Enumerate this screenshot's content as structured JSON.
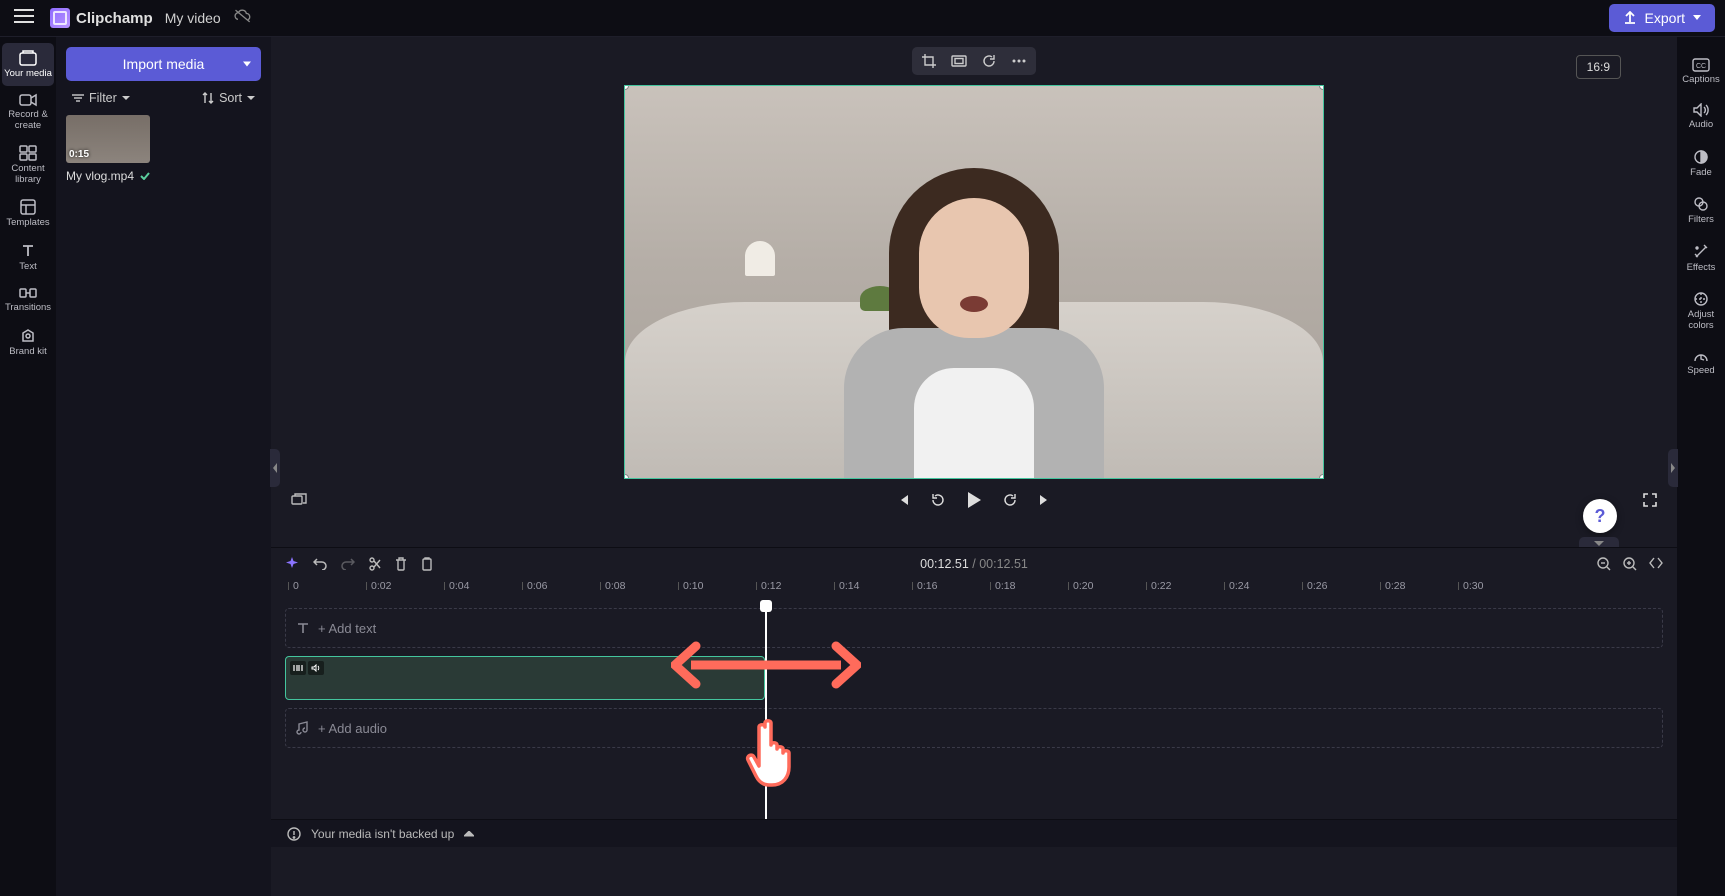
{
  "app": {
    "name": "Clipchamp",
    "video_name": "My video"
  },
  "export": {
    "label": "Export"
  },
  "rail": {
    "your_media": "Your media",
    "record_create": "Record & create",
    "content_library": "Content library",
    "templates": "Templates",
    "text": "Text",
    "transitions": "Transitions",
    "brand_kit": "Brand kit"
  },
  "panel": {
    "import": "Import media",
    "filter": "Filter",
    "sort": "Sort",
    "media": {
      "duration": "0:15",
      "name": "My vlog.mp4"
    }
  },
  "preview": {
    "aspect": "16:9"
  },
  "props": {
    "captions": "Captions",
    "audio": "Audio",
    "fade": "Fade",
    "filters": "Filters",
    "effects": "Effects",
    "adjust_colors": "Adjust colors",
    "speed": "Speed"
  },
  "timeline": {
    "current": "00:12.51",
    "separator": " / ",
    "total": "00:12.51",
    "ticks": [
      "0",
      "0:02",
      "0:04",
      "0:06",
      "0:08",
      "0:10",
      "0:12",
      "0:14",
      "0:16",
      "0:18",
      "0:20",
      "0:22",
      "0:24",
      "0:26",
      "0:28",
      "0:30"
    ],
    "add_text": "+ Add text",
    "add_audio": "+ Add audio"
  },
  "footer": {
    "backup": "Your media isn't backed up"
  }
}
